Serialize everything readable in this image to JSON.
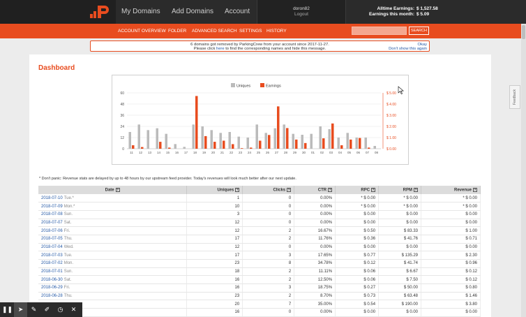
{
  "topnav": {
    "my_domains": "My Domains",
    "add_domains": "Add Domains",
    "account": "Account"
  },
  "user": {
    "name": "doron82",
    "logout": "Logout"
  },
  "earnings": {
    "alltime_label": "Alltime Earnings:",
    "alltime_value": "$ 1,527.58",
    "month_label": "Earnings this month:",
    "month_value": "$ 5.09"
  },
  "subnav": [
    "ACCOUNT OVERVIEW",
    "FOLDER",
    "ADVANCED SEARCH",
    "SETTINGS",
    "HISTORY"
  ],
  "search": {
    "placeholder": "",
    "button": "SEARCH"
  },
  "notice": {
    "line1": "6 domains got removed by ParkingCrew from your account since 2017-11-27.",
    "line2_pre": "Please click ",
    "line2_link": "here",
    "line2_post": " to find the corresponding names and hide this message.",
    "okay": "Okay",
    "dont_show": "Don't show this again"
  },
  "page_title": "Dashboard",
  "disclaimer": "* Don't panic: Revenue stats are delayed by up to 48 hours by our upstream feed provider. Today's revenues will look much better after our next update.",
  "chart_data": {
    "type": "bar",
    "categories": [
      "11",
      "12",
      "13",
      "14",
      "15",
      "16",
      "17",
      "18",
      "19",
      "20",
      "21",
      "22",
      "23",
      "24",
      "25",
      "26",
      "27",
      "28",
      "29",
      "30",
      "01",
      "02",
      "03",
      "04",
      "05",
      "06",
      "07",
      "08"
    ],
    "series": [
      {
        "name": "Uniques",
        "color": "#bbbbbb",
        "axis": "left",
        "values": [
          18,
          26,
          20,
          22,
          16,
          5,
          2,
          26,
          24,
          20,
          17,
          18,
          13,
          12,
          26,
          17,
          22,
          26,
          16,
          15,
          16,
          24,
          21,
          12,
          17,
          12,
          12,
          3
        ]
      },
      {
        "name": "Earnings",
        "color": "#e84c1f",
        "axis": "right",
        "values": [
          0.31,
          0.15,
          0.0,
          0.62,
          0.1,
          0.0,
          0.0,
          4.72,
          1.13,
          0.62,
          0.72,
          0.41,
          0.05,
          0.1,
          0.72,
          1.23,
          3.79,
          1.85,
          0.82,
          0.51,
          0.0,
          0.93,
          2.26,
          0.31,
          0.82,
          0.96,
          0.1,
          0.0
        ]
      }
    ],
    "yleft": {
      "ticks": [
        0,
        12,
        24,
        36,
        48,
        60
      ],
      "ylim": [
        0,
        60
      ]
    },
    "yright": {
      "ticks": [
        "$ 0.00",
        "$ 1.00",
        "$ 2.00",
        "$ 3.00",
        "$ 4.00",
        "$ 5.00"
      ],
      "ylim": [
        0,
        5
      ]
    },
    "legend_position": "top-center",
    "grid": true
  },
  "table": {
    "headers": [
      "Date",
      "Uniques",
      "Clicks",
      "CTR",
      "RPC",
      "RPM",
      "Revenue"
    ],
    "rows": [
      {
        "date": "2018-07-10",
        "dow": "Tue.*",
        "uniques": "1",
        "clicks": "0",
        "ctr": "0.00%",
        "rpc": "* $ 0.00",
        "rpm": "* $ 0.00",
        "revenue": "* $ 0.00"
      },
      {
        "date": "2018-07-09",
        "dow": "Mon.*",
        "uniques": "10",
        "clicks": "0",
        "ctr": "0.00%",
        "rpc": "* $ 0.00",
        "rpm": "* $ 0.00",
        "revenue": "* $ 0.00"
      },
      {
        "date": "2018-07-08",
        "dow": "Sun.",
        "uniques": "3",
        "clicks": "0",
        "ctr": "0.00%",
        "rpc": "$ 0.00",
        "rpm": "$ 0.00",
        "revenue": "$ 0.00"
      },
      {
        "date": "2018-07-07",
        "dow": "Sat.",
        "uniques": "12",
        "clicks": "0",
        "ctr": "0.00%",
        "rpc": "$ 0.00",
        "rpm": "$ 0.00",
        "revenue": "$ 0.00"
      },
      {
        "date": "2018-07-06",
        "dow": "Fri.",
        "uniques": "12",
        "clicks": "2",
        "ctr": "16.67%",
        "rpc": "$ 0.50",
        "rpm": "$ 83.33",
        "revenue": "$ 1.00"
      },
      {
        "date": "2018-07-05",
        "dow": "Thu.",
        "uniques": "17",
        "clicks": "2",
        "ctr": "11.76%",
        "rpc": "$ 0.36",
        "rpm": "$ 41.76",
        "revenue": "$ 0.71"
      },
      {
        "date": "2018-07-04",
        "dow": "Wed.",
        "uniques": "12",
        "clicks": "0",
        "ctr": "0.00%",
        "rpc": "$ 0.00",
        "rpm": "$ 0.00",
        "revenue": "$ 0.00"
      },
      {
        "date": "2018-07-03",
        "dow": "Tue.",
        "uniques": "17",
        "clicks": "3",
        "ctr": "17.65%",
        "rpc": "$ 0.77",
        "rpm": "$ 135.29",
        "revenue": "$ 2.30"
      },
      {
        "date": "2018-07-02",
        "dow": "Mon.",
        "uniques": "23",
        "clicks": "8",
        "ctr": "34.78%",
        "rpc": "$ 0.12",
        "rpm": "$ 41.74",
        "revenue": "$ 0.96"
      },
      {
        "date": "2018-07-01",
        "dow": "Sun.",
        "uniques": "18",
        "clicks": "2",
        "ctr": "11.11%",
        "rpc": "$ 0.06",
        "rpm": "$ 6.67",
        "revenue": "$ 0.12"
      },
      {
        "date": "2018-06-30",
        "dow": "Sat.",
        "uniques": "16",
        "clicks": "2",
        "ctr": "12.50%",
        "rpc": "$ 0.06",
        "rpm": "$ 7.50",
        "revenue": "$ 0.12"
      },
      {
        "date": "2018-06-29",
        "dow": "Fri.",
        "uniques": "16",
        "clicks": "3",
        "ctr": "18.75%",
        "rpc": "$ 0.27",
        "rpm": "$ 50.00",
        "revenue": "$ 0.80"
      },
      {
        "date": "2018-06-28",
        "dow": "Thu.",
        "uniques": "23",
        "clicks": "2",
        "ctr": "8.70%",
        "rpc": "$ 0.73",
        "rpm": "$ 63.48",
        "revenue": "$ 1.46"
      },
      {
        "date": "",
        "dow": "",
        "uniques": "20",
        "clicks": "7",
        "ctr": "35.00%",
        "rpc": "$ 0.54",
        "rpm": "$ 190.00",
        "revenue": "$ 3.80"
      },
      {
        "date": "",
        "dow": "",
        "uniques": "16",
        "clicks": "0",
        "ctr": "0.00%",
        "rpc": "$ 0.00",
        "rpm": "$ 0.00",
        "revenue": "$ 0.00"
      }
    ]
  },
  "feedback": "Feedback",
  "toolbar": {
    "icons": [
      "pause-icon",
      "cursor-icon",
      "pen-icon",
      "highlighter-icon",
      "timer-icon",
      "close-icon"
    ],
    "glyphs": [
      "❚❚",
      "➤",
      "✎",
      "✐",
      "◷",
      "✕"
    ]
  }
}
